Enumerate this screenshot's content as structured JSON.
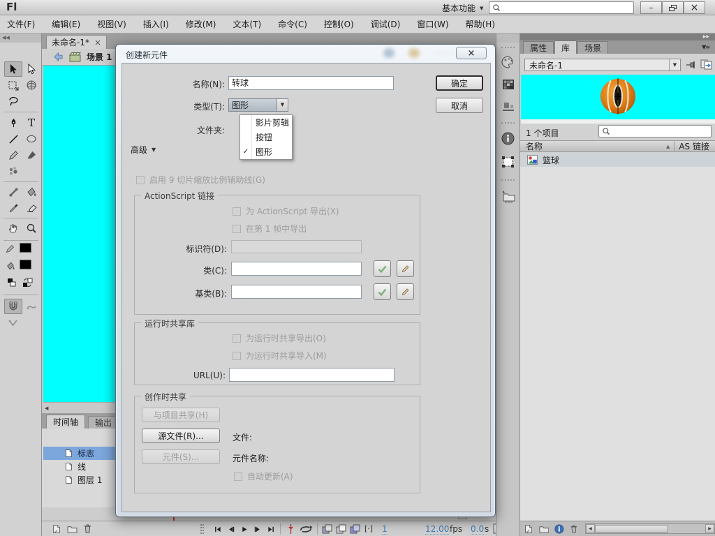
{
  "window": {
    "logo": "Fl",
    "workspace": "基本功能",
    "search_value": ""
  },
  "menubar": {
    "items": [
      "文件(F)",
      "编辑(E)",
      "视图(V)",
      "插入(I)",
      "修改(M)",
      "文本(T)",
      "命令(C)",
      "控制(O)",
      "调试(D)",
      "窗口(W)",
      "帮助(H)"
    ]
  },
  "document": {
    "tab": "未命名-1*",
    "scene": "场景 1"
  },
  "dialog": {
    "title": "创建新元件",
    "name_label": "名称(N):",
    "name_value": "转球",
    "type_label": "类型(T):",
    "type_value": "图形",
    "type_options": [
      "影片剪辑",
      "按钮",
      "图形"
    ],
    "folder_label": "文件夹:",
    "advanced": "高级",
    "ok": "确定",
    "cancel": "取消",
    "scale9": "启用 9 切片缩放比例辅助线(G)",
    "as_link": {
      "title": "ActionScript 链接",
      "export_as": "为 ActionScript 导出(X)",
      "export_frame1": "在第 1 帧中导出",
      "identifier": "标识符(D):",
      "class": "类(C):",
      "base": "基类(B):"
    },
    "runtime": {
      "title": "运行时共享库",
      "export_rt": "为运行时共享导出(O)",
      "import_rt": "为运行时共享导入(M)",
      "url": "URL(U):"
    },
    "authoring": {
      "title": "创作时共享",
      "share_project": "与项目共享(H)",
      "source_file": "源文件(R)...",
      "file_label": "文件:",
      "symbol": "元件(S)...",
      "symbol_name": "元件名称:",
      "auto_update": "自动更新(A)"
    }
  },
  "timeline": {
    "tabs": [
      "时间轴",
      "输出"
    ],
    "layers": [
      "标志",
      "线",
      "图层 1"
    ],
    "frame": "1",
    "fps_value": "12.00",
    "fps_unit": "fps",
    "time_value": "0.0",
    "time_unit": "s"
  },
  "library": {
    "tabs": [
      "属性",
      "库",
      "场景"
    ],
    "doc_name": "未命名-1",
    "item_count": "1 个项目",
    "col_name": "名称",
    "col_link": "AS 链接",
    "items": [
      {
        "name": "篮球"
      }
    ]
  },
  "icons": {
    "collapse_left": "◀◀",
    "collapse_right": "▶▶",
    "panel_menu": "▼≡",
    "combo_arrow": "▼",
    "menu_check": "✓",
    "advanced_arrow": "▼",
    "sort_arrow": "▲",
    "tab_close": "×",
    "win_min": "–",
    "win_close": "×",
    "scroll_left": "◀",
    "scroll_right": "▶",
    "scroll_down": "▼",
    "workspace_arrow": "▼",
    "onion_bracket": "[·]"
  },
  "colors": {
    "stage": "#00ffff",
    "selection": "#7ba7dc",
    "hot_text": "#3d7ab5"
  }
}
